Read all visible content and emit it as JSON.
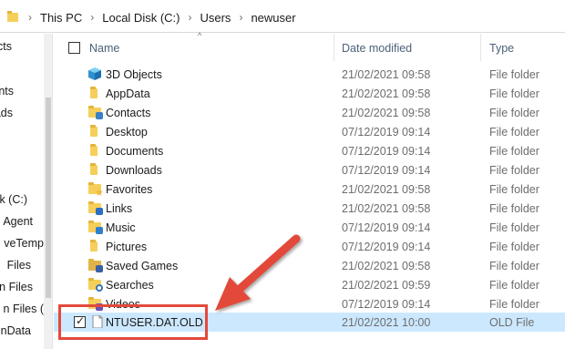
{
  "address": {
    "crumbs": [
      "This PC",
      "Local Disk (C:)",
      "Users",
      "newuser"
    ]
  },
  "nav": {
    "items": [
      "ects",
      "nts",
      "ads",
      "k (C:)",
      "Agent",
      "veTemp",
      "Files",
      "n Files",
      "n Files (",
      "nData"
    ]
  },
  "columns": {
    "name": "Name",
    "date": "Date modified",
    "type": "Type"
  },
  "rows": [
    {
      "name": "3D Objects",
      "date": "21/02/2021 09:58",
      "type": "File folder",
      "icon": "3d-objects-icon"
    },
    {
      "name": "AppData",
      "date": "21/02/2021 09:58",
      "type": "File folder",
      "icon": "folder-icon"
    },
    {
      "name": "Contacts",
      "date": "21/02/2021 09:58",
      "type": "File folder",
      "icon": "contacts-folder-icon"
    },
    {
      "name": "Desktop",
      "date": "07/12/2019 09:14",
      "type": "File folder",
      "icon": "folder-icon"
    },
    {
      "name": "Documents",
      "date": "07/12/2019 09:14",
      "type": "File folder",
      "icon": "folder-icon"
    },
    {
      "name": "Downloads",
      "date": "07/12/2019 09:14",
      "type": "File folder",
      "icon": "downloads-folder-icon"
    },
    {
      "name": "Favorites",
      "date": "21/02/2021 09:58",
      "type": "File folder",
      "icon": "favorites-folder-icon"
    },
    {
      "name": "Links",
      "date": "21/02/2021 09:58",
      "type": "File folder",
      "icon": "links-folder-icon"
    },
    {
      "name": "Music",
      "date": "07/12/2019 09:14",
      "type": "File folder",
      "icon": "music-folder-icon"
    },
    {
      "name": "Pictures",
      "date": "07/12/2019 09:14",
      "type": "File folder",
      "icon": "folder-icon"
    },
    {
      "name": "Saved Games",
      "date": "21/02/2021 09:58",
      "type": "File folder",
      "icon": "saved-games-folder-icon"
    },
    {
      "name": "Searches",
      "date": "21/02/2021 09:59",
      "type": "File folder",
      "icon": "searches-folder-icon"
    },
    {
      "name": "Videos",
      "date": "07/12/2019 09:14",
      "type": "File folder",
      "icon": "videos-folder-icon"
    },
    {
      "name": "NTUSER.DAT.OLD",
      "date": "21/02/2021 10:00",
      "type": "OLD File",
      "icon": "file-icon",
      "selected": true
    }
  ],
  "colors": {
    "selection": "#cce8ff",
    "annotation": "#e24a3b",
    "folder": "#f6cf5a"
  }
}
